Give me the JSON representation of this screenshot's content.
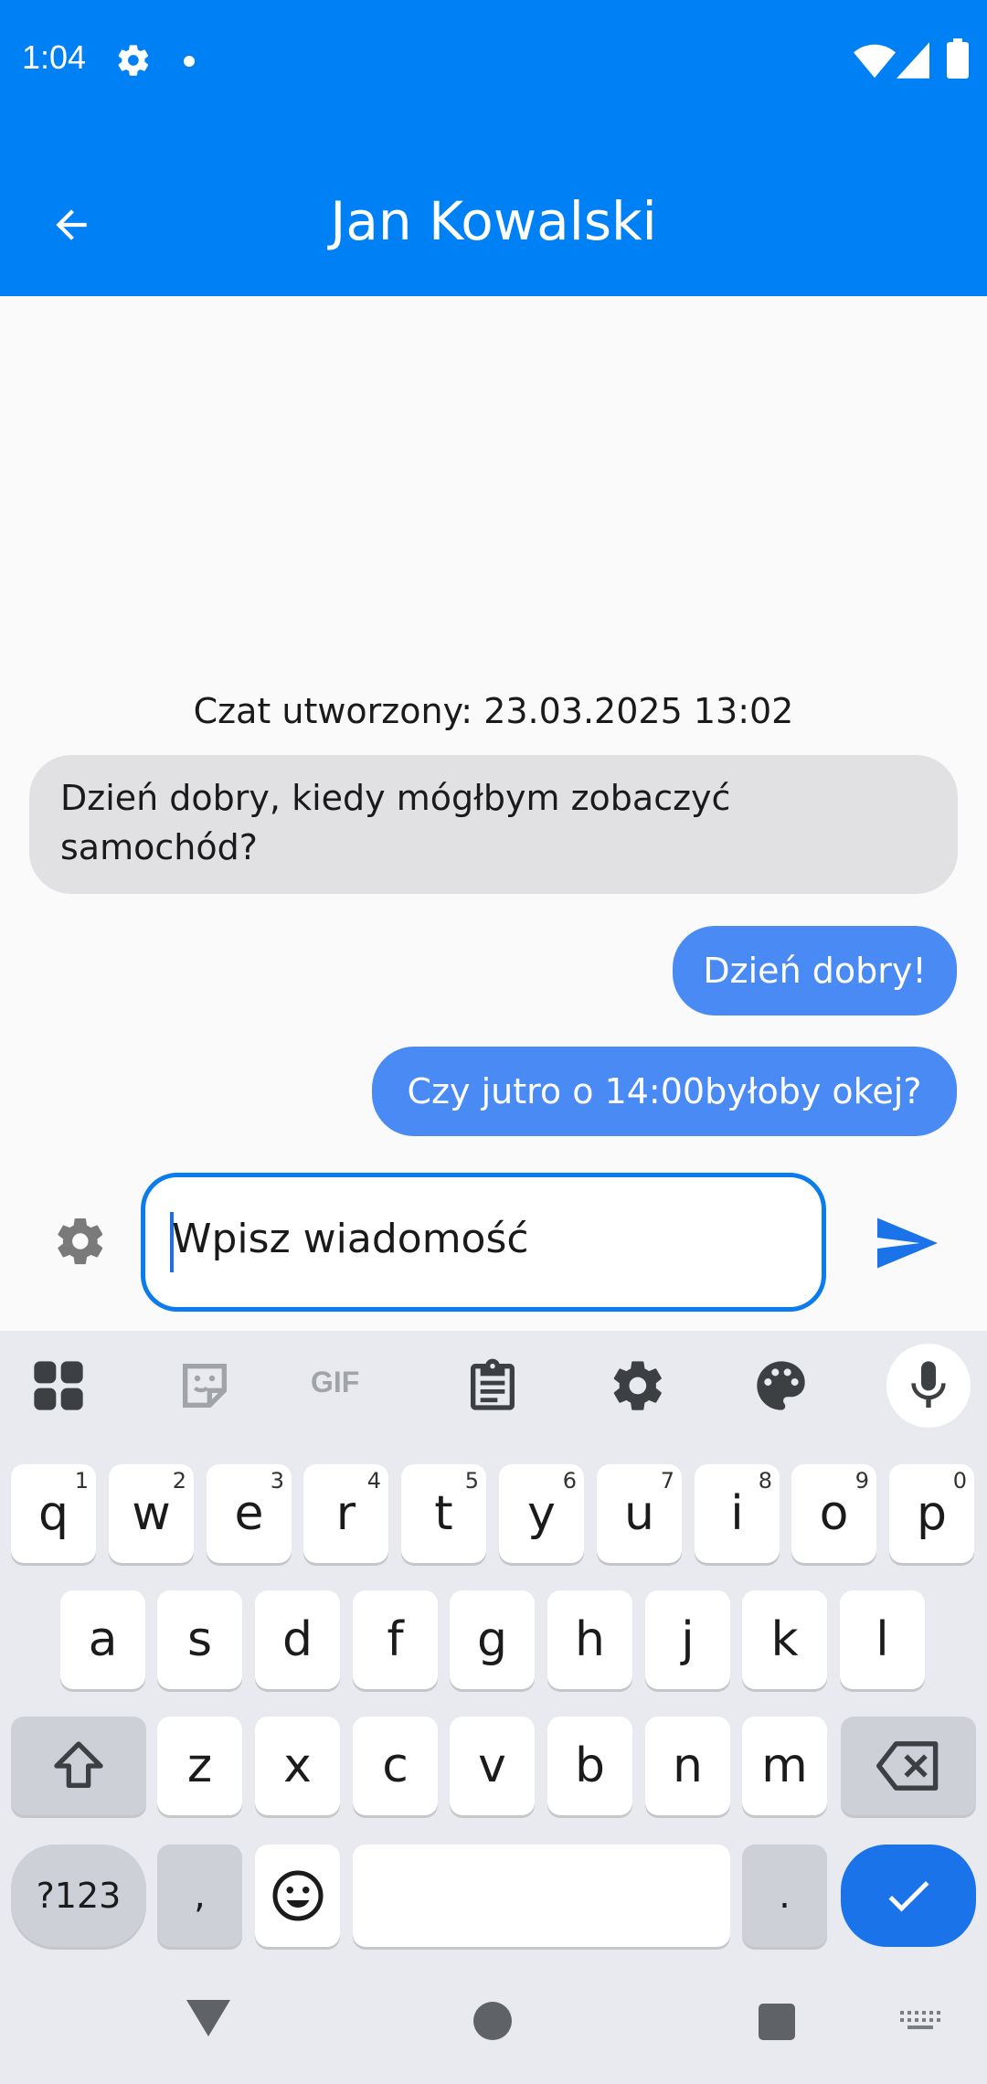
{
  "status_bar": {
    "time": "1:04"
  },
  "app_bar": {
    "title": "Jan Kowalski"
  },
  "chat": {
    "created_label": "Czat utworzony: 23.03.2025 13:02",
    "messages": [
      {
        "text": "Dzień dobry, kiedy mógłbym zobaczyć samochód?",
        "sender": "other"
      },
      {
        "text": "Dzień dobry!",
        "sender": "me"
      },
      {
        "text": "Czy jutro o 14:00byłoby okej?",
        "sender": "me"
      }
    ]
  },
  "composer": {
    "placeholder": "Wpisz wiadomość"
  },
  "keyboard": {
    "toolbar": [
      "apps-icon",
      "sticker-icon",
      "gif-icon",
      "clipboard-icon",
      "settings-icon",
      "palette-icon",
      "mic-icon"
    ],
    "gif_label": "GIF",
    "row1": [
      "q",
      "w",
      "e",
      "r",
      "t",
      "y",
      "u",
      "i",
      "o",
      "p"
    ],
    "row1_hints": [
      "1",
      "2",
      "3",
      "4",
      "5",
      "6",
      "7",
      "8",
      "9",
      "0"
    ],
    "row2": [
      "a",
      "s",
      "d",
      "f",
      "g",
      "h",
      "j",
      "k",
      "l"
    ],
    "row3": [
      "z",
      "x",
      "c",
      "v",
      "b",
      "n",
      "m"
    ],
    "symbols_label": "?123",
    "comma": ",",
    "period": "."
  },
  "colors": {
    "primary": "#0080F5",
    "bubble_me": "#4A8AF4",
    "bubble_other": "#E1E0E2",
    "enter": "#1A73E8"
  }
}
